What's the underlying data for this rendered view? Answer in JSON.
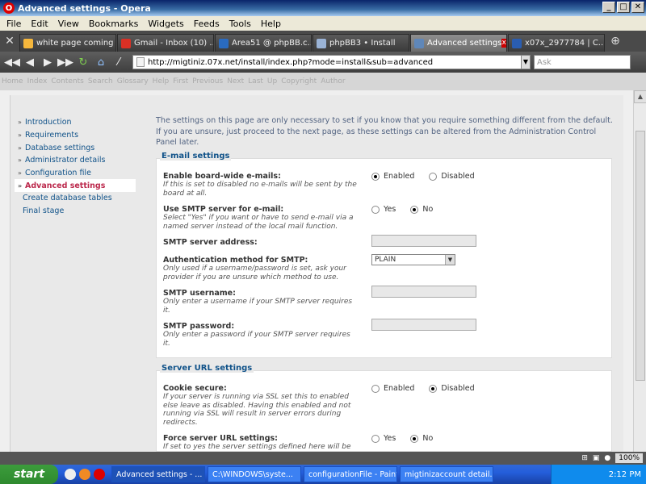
{
  "window": {
    "title": "Advanced settings - Opera"
  },
  "menu": [
    "File",
    "Edit",
    "View",
    "Bookmarks",
    "Widgets",
    "Feeds",
    "Tools",
    "Help"
  ],
  "tabs": [
    {
      "label": "white page coming ...",
      "color": "#f6b73c",
      "active": false
    },
    {
      "label": "Gmail - Inbox (10) ...",
      "color": "#d93025",
      "active": false
    },
    {
      "label": "Area51 @ phpBB.c...",
      "color": "#2a6bc0",
      "active": false
    },
    {
      "label": "phpBB3 • Install",
      "color": "#9ab3d6",
      "active": false
    },
    {
      "label": "Advanced settings",
      "color": "#5f87b9",
      "active": true
    },
    {
      "label": "x07x_2977784 | C...",
      "color": "#2a5db0",
      "active": false
    }
  ],
  "address": {
    "url": "http://migtiniz.07x.net/install/index.php?mode=install&sub=advanced",
    "search_placeholder": "Ask"
  },
  "linkbar": [
    "Home",
    "Index",
    "Contents",
    "Search",
    "Glossary",
    "Help",
    "First",
    "Previous",
    "Next",
    "Last",
    "Up",
    "Copyright",
    "Author"
  ],
  "sidebar": {
    "items": [
      {
        "label": "Introduction",
        "type": "done"
      },
      {
        "label": "Requirements",
        "type": "done"
      },
      {
        "label": "Database settings",
        "type": "done"
      },
      {
        "label": "Administrator details",
        "type": "done"
      },
      {
        "label": "Configuration file",
        "type": "done"
      },
      {
        "label": "Advanced settings",
        "type": "active"
      },
      {
        "label": "Create database tables",
        "type": "plain"
      },
      {
        "label": "Final stage",
        "type": "plain"
      }
    ]
  },
  "intro": "The settings on this page are only necessary to set if you know that you require something different from the default. If you are unsure, just proceed to the next page, as these settings can be altered from the Administration Control Panel later.",
  "email": {
    "legend": "E-mail settings",
    "board_email": {
      "label": "Enable board-wide e-mails:",
      "explain": "If this is set to disabled no e-mails will be sent by the board at all.",
      "opt1": "Enabled",
      "opt2": "Disabled"
    },
    "smtp": {
      "label": "Use SMTP server for e-mail:",
      "explain": "Select \"Yes\" if you want or have to send e-mail via a named server instead of the local mail function.",
      "opt1": "Yes",
      "opt2": "No"
    },
    "smtp_host": {
      "label": "SMTP server address:"
    },
    "auth": {
      "label": "Authentication method for SMTP:",
      "explain": "Only used if a username/password is set, ask your provider if you are unsure which method to use.",
      "value": "PLAIN"
    },
    "smtp_user": {
      "label": "SMTP username:",
      "explain": "Only enter a username if your SMTP server requires it."
    },
    "smtp_pass": {
      "label": "SMTP password:",
      "explain": "Only enter a password if your SMTP server requires it."
    }
  },
  "server": {
    "legend": "Server URL settings",
    "cookie": {
      "label": "Cookie secure:",
      "explain": "If your server is running via SSL set this to enabled else leave as disabled. Having this enabled and not running via SSL will result in server errors during redirects.",
      "opt1": "Enabled",
      "opt2": "Disabled"
    },
    "force": {
      "label": "Force server URL settings:",
      "explain": "If set to yes the server settings defined here will be",
      "opt1": "Yes",
      "opt2": "No"
    }
  },
  "status": {
    "zoom": "100%"
  },
  "taskbar": {
    "start": "start",
    "tasks": [
      {
        "label": "Advanced settings - ...",
        "active": true
      },
      {
        "label": "C:\\WINDOWS\\syste...",
        "active": false
      },
      {
        "label": "configurationFile - Paint",
        "active": false
      },
      {
        "label": "migtinizaccount detail...",
        "active": false
      }
    ],
    "clock": "2:12 PM"
  }
}
